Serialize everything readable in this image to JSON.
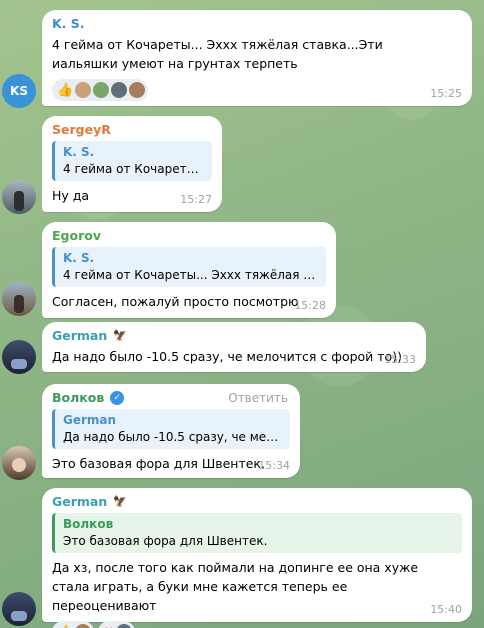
{
  "colors": {
    "name_ks": "#3a8fd4",
    "name_sergeyr": "#e07a3c",
    "name_egorov": "#4aaa4a",
    "name_german": "#3a9fb0",
    "name_volkov": "#3a9c5a",
    "avatar_ks": "#3a93d8"
  },
  "messages": [
    {
      "sender": "K. S.",
      "text": "4 гейма от Кочареты... Эххх тяжёлая ставка...Эти иальяшки умеют на грунтах терпеть",
      "time": "15:25",
      "avatar_initials": "KS",
      "reactions": [
        "thumbs-up",
        "avatar-group"
      ]
    },
    {
      "sender": "SergeyR",
      "reply_name": "K. S.",
      "reply_text": "4 гейма от Кочареты....",
      "text": "Ну да",
      "time": "15:27"
    },
    {
      "sender": "Egorov",
      "reply_name": "K. S.",
      "reply_text": "4 гейма от Кочареты... Эххх тяжёлая ста...",
      "text": "Согласен, пожалуй просто посмотрю",
      "time": "15:28"
    },
    {
      "sender": "German",
      "text": "Да надо было -10.5 сразу, че мелочится с форой то))",
      "time": "15:33"
    },
    {
      "sender": "Волков",
      "reply_action": "Ответить",
      "reply_name": "German",
      "reply_text": "Да надо было -10.5 сразу, че мело...",
      "text": "Это базовая фора для Швентек.",
      "time": "15:34"
    },
    {
      "sender": "German",
      "reply_name": "Волков",
      "reply_text": "Это базовая фора для Швентек.",
      "text": "Да хз, после того как поймали на допинге ее она хуже стала играть, а буки мне кажется теперь ее переоценивают",
      "time": "15:40",
      "reactions": [
        "thumbs-up",
        "heart"
      ]
    }
  ]
}
